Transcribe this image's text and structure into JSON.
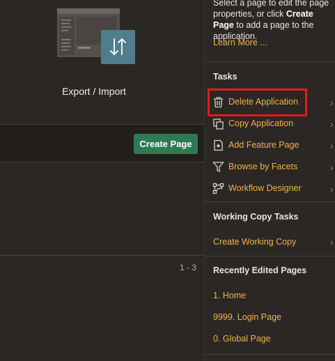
{
  "tile": {
    "label": "Export / Import"
  },
  "toolbar": {
    "create_page_label": "Create Page"
  },
  "pagination": {
    "range": "1 - 3"
  },
  "sidebar": {
    "intro_prefix": "Select a page to edit the page properties, or click ",
    "intro_bold": "Create Page",
    "intro_suffix": " to add a page to the application.",
    "learn_more": "Learn More ...",
    "tasks_heading": "Tasks",
    "tasks": [
      {
        "label": "Delete Application",
        "icon": "trash-icon"
      },
      {
        "label": "Copy Application",
        "icon": "copy-icon"
      },
      {
        "label": "Add Feature Page",
        "icon": "feature-page-icon"
      },
      {
        "label": "Browse by Facets",
        "icon": "filter-icon"
      },
      {
        "label": "Workflow Designer",
        "icon": "workflow-icon"
      }
    ],
    "working_copy_heading": "Working Copy Tasks",
    "working_copy_link": "Create Working Copy",
    "recent_heading": "Recently Edited Pages",
    "recent_pages": [
      "1. Home",
      "9999. Login Page",
      "0. Global Page"
    ]
  },
  "colors": {
    "accent": "#f0b34a",
    "create_button": "#2f7a53",
    "highlight": "#e11b1b"
  }
}
